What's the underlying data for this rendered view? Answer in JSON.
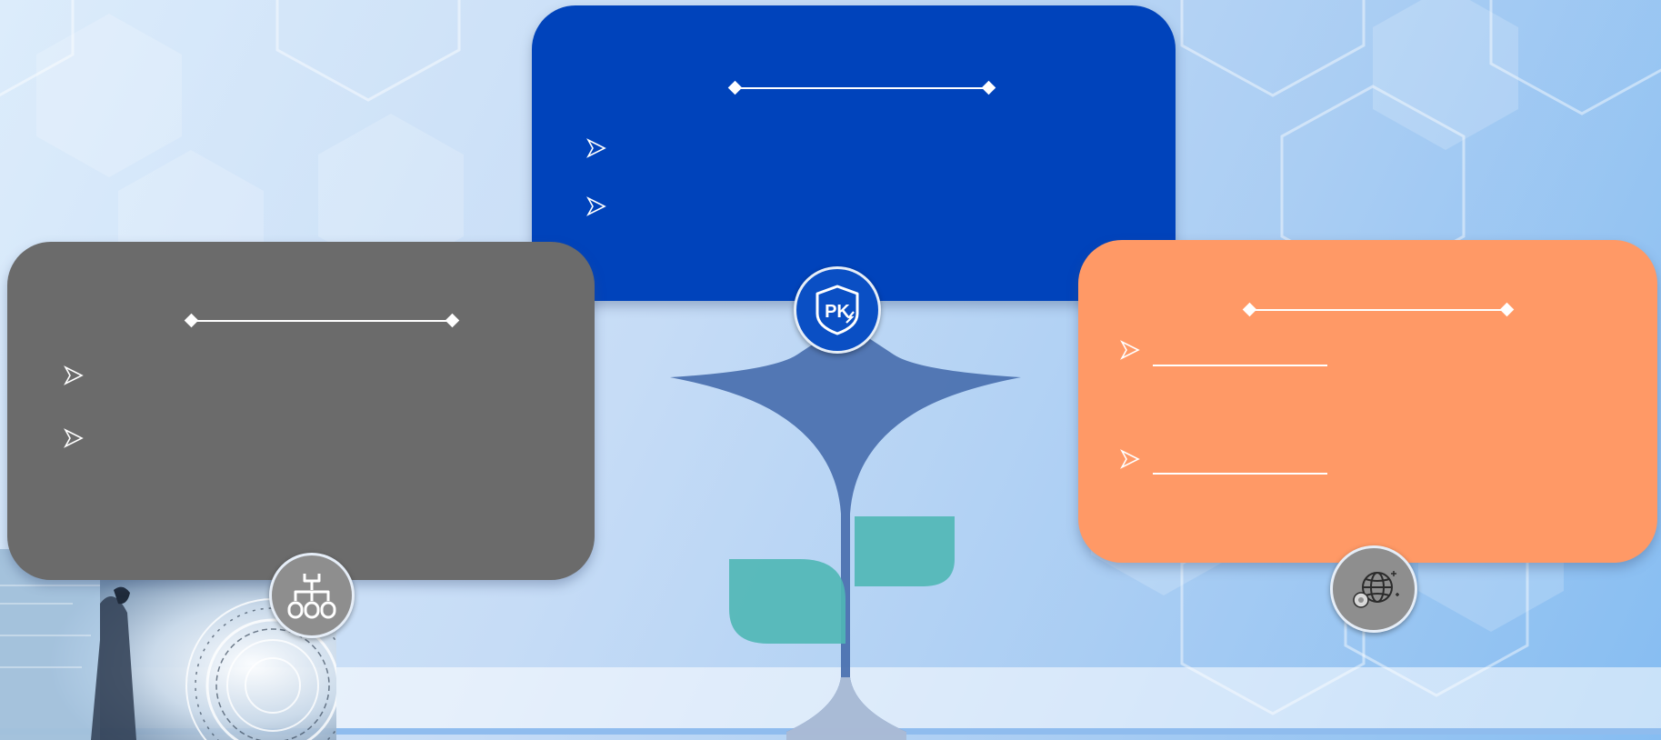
{
  "colors": {
    "card_blue": "#0043bb",
    "card_gray": "#6b6b6b",
    "card_orange": "#ff9966",
    "plant_stem": "#4c72b0",
    "leaves": "#4fb7b5",
    "badge_blue": "#0a4fc4",
    "badge_gray": "#8e8e8e"
  },
  "cards": {
    "top": {
      "bullets": [
        "",
        ""
      ]
    },
    "left": {
      "bullets": [
        "",
        ""
      ]
    },
    "right": {
      "bullets": [
        "",
        ""
      ]
    }
  },
  "icons": {
    "top_badge": "pk-shield-icon",
    "left_badge": "hierarchy-network-icon",
    "right_badge": "globe-gear-icon",
    "bullet": "arrowhead-bullet-icon",
    "center": "sprout-plant-icon"
  },
  "badges": {
    "top_text": "PK"
  }
}
